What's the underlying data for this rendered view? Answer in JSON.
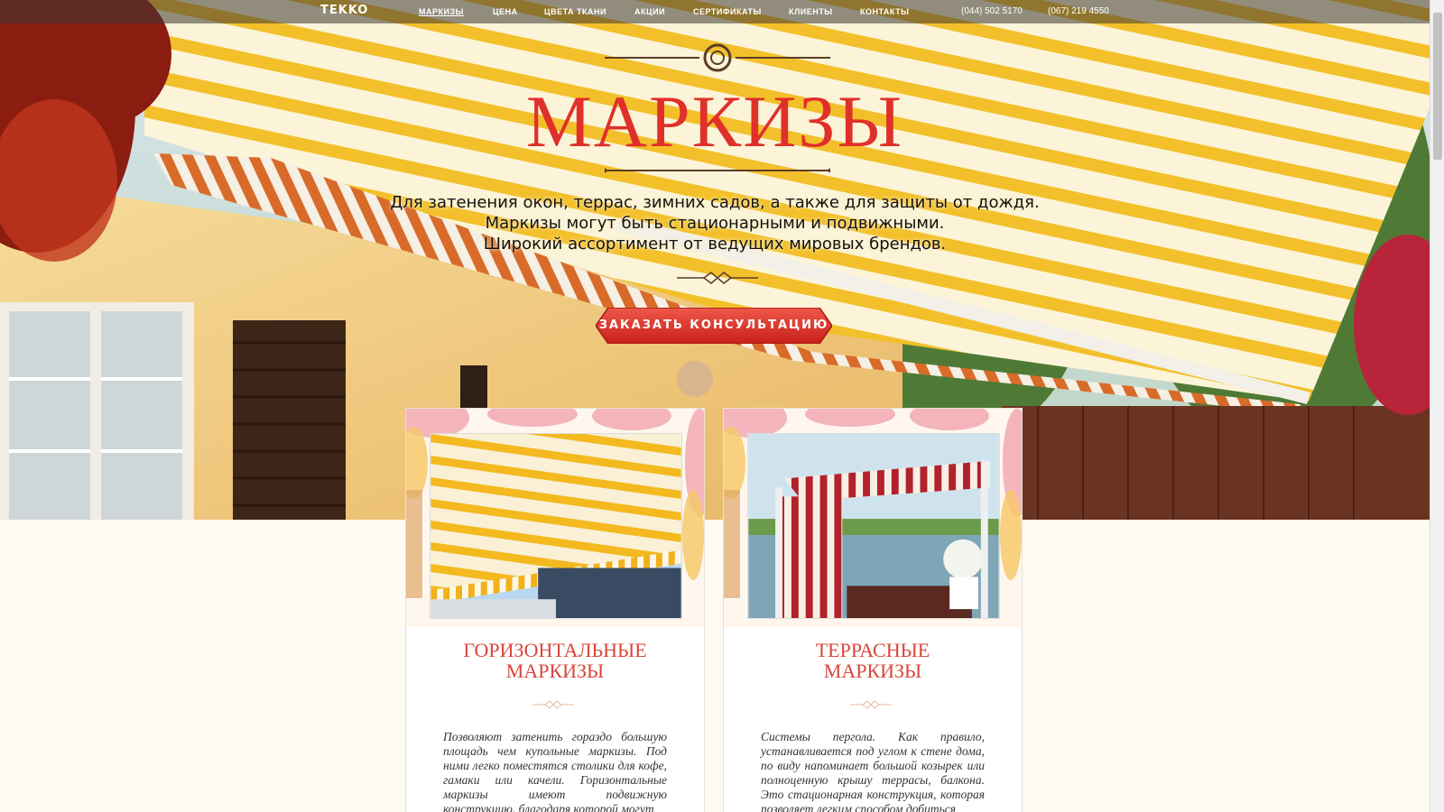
{
  "nav": {
    "logo": "TEKKO",
    "items": [
      {
        "label": "МАРКИЗЫ",
        "active": true
      },
      {
        "label": "ЦЕНА"
      },
      {
        "label": "ЦВЕТА ТКАНИ"
      },
      {
        "label": "АКЦИИ"
      },
      {
        "label": "СЕРТИФИКАТЫ"
      },
      {
        "label": "КЛИЕНТЫ"
      },
      {
        "label": "КОНТАКТЫ"
      }
    ],
    "phones": [
      "(044) 502 5170",
      "(067) 219 4550"
    ]
  },
  "hero": {
    "title": "МАРКИЗЫ",
    "subtitle_lines": [
      "Для затенения окон, террас, зимних садов, а также для защиты от дождя.",
      "Маркизы могут быть стационарными и подвижными.",
      "Широкий ассортимент от ведущих мировых брендов."
    ],
    "cta_label": "ЗАКАЗАТЬ КОНСУЛЬТАЦИЮ"
  },
  "cards": [
    {
      "title_lines": [
        "ГОРИЗОНТАЛЬНЫЕ",
        "МАРКИЗЫ"
      ],
      "text": "Позволяют затенить гораздо большую площадь чем купольные маркизы. Под ними легко поместятся столики для кофе, гамаки или качели. Горизонтальные маркизы имеют подвижную конструкцию, благодаря которой могут"
    },
    {
      "title_lines": [
        "ТЕРРАСНЫЕ",
        "МАРКИЗЫ"
      ],
      "text": "Системы пергола. Как правило, устанавливается под углом к стене дома, по виду напоминает большой козырек или полноценную крышу террасы, балкона. Это стационарная конструкция, которая позволяет легким способом добиться"
    }
  ],
  "colors": {
    "accent": "#e0302a",
    "card_title": "#d9463a",
    "page_bg": "#fdfbf2"
  }
}
